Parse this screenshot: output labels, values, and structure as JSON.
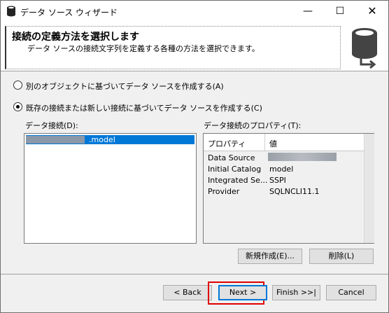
{
  "window": {
    "title": "データ ソース ウィザード",
    "controls": {
      "minimize": "—",
      "maximize": "☐",
      "close": "✕"
    }
  },
  "header": {
    "title": "接続の定義方法を選択します",
    "subtitle": "データ ソースの接続文字列を定義する各種の方法を選択できます。"
  },
  "options": {
    "option1": {
      "label": "別のオブジェクトに基づいてデータ ソースを作成する(A)",
      "selected": false
    },
    "option2": {
      "label": "既存の接続または新しい接続に基づいてデータ ソースを作成する(C)",
      "selected": true
    }
  },
  "connections": {
    "label": "データ接続(D):",
    "items": [
      {
        "label": ".model",
        "selected": true
      }
    ]
  },
  "properties": {
    "label": "データ接続のプロパティ(T):",
    "columns": {
      "name": "プロパティ",
      "value": "値"
    },
    "rows": [
      {
        "name": "Data Source",
        "value": ""
      },
      {
        "name": "Initial Catalog",
        "value": "model"
      },
      {
        "name": "Integrated Se...",
        "value": "SSPI"
      },
      {
        "name": "Provider",
        "value": "SQLNCLI11.1"
      }
    ]
  },
  "buttons": {
    "new": "新規作成(E)...",
    "delete": "削除(L)",
    "back": "< Back",
    "next": "Next >",
    "finish": "Finish >>|",
    "cancel": "Cancel"
  }
}
